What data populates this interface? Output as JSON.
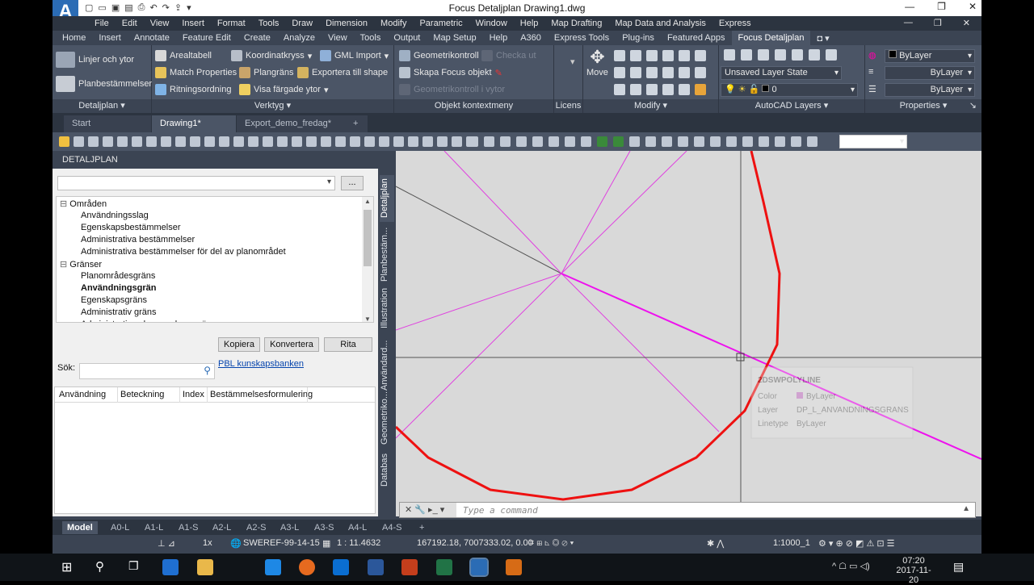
{
  "app": {
    "title": "Focus Detaljplan    Drawing1.dwg",
    "logo_text": "A",
    "logo_sub": "M3D"
  },
  "menubar": [
    "File",
    "Edit",
    "View",
    "Insert",
    "Format",
    "Tools",
    "Draw",
    "Dimension",
    "Modify",
    "Parametric",
    "Window",
    "Help",
    "Map Drafting",
    "Map Data and Analysis",
    "Express"
  ],
  "ribbon_tabs": [
    "Home",
    "Insert",
    "Annotate",
    "Feature Edit",
    "Create",
    "Analyze",
    "View",
    "Tools",
    "Output",
    "Map Setup",
    "Help",
    "A360",
    "Express Tools",
    "Plug-ins",
    "Featured Apps",
    "Focus Detaljplan"
  ],
  "ribbon_active_tab": "Focus Detaljplan",
  "ribbon": {
    "detaljplan": {
      "title": "Detaljplan",
      "btn1": "Linjer och ytor",
      "btn2": "Planbestämmelser"
    },
    "verktyg": {
      "title": "Verktyg",
      "areal": "Arealtabell",
      "koord": "Koordinatkryss",
      "gml": "GML Import",
      "match": "Match Properties",
      "plangrans": "Plangräns",
      "exportera": "Exportera till shape",
      "ritning": "Ritningsordning",
      "visa": "Visa färgade ytor"
    },
    "objekt": {
      "title": "Objekt kontextmeny",
      "geom": "Geometrikontroll",
      "checka": "Checka ut",
      "skapa": "Skapa Focus objekt",
      "geomkontroll": "Geometrikontroll i vytor"
    },
    "licens": {
      "title": "Licens"
    },
    "modify": {
      "title": "Modify",
      "move": "Move"
    },
    "layers": {
      "title": "AutoCAD Layers",
      "state": "Unsaved Layer State",
      "layer0": "0"
    },
    "properties": {
      "title": "Properties",
      "color": "ByLayer",
      "lt1": "ByLayer",
      "lt2": "ByLayer"
    }
  },
  "doc_tabs": [
    "Start",
    "Drawing1*",
    "Export_demo_fredag*"
  ],
  "palette": {
    "header": "DETALJPLAN",
    "dots": "...",
    "tree": [
      {
        "label": "Områden",
        "level": 0,
        "bold": false
      },
      {
        "label": "Användningsslag",
        "level": 1,
        "bold": false
      },
      {
        "label": "Egenskapsbestämmelser",
        "level": 1,
        "bold": false
      },
      {
        "label": "Administrativa bestämmelser",
        "level": 1,
        "bold": false
      },
      {
        "label": "Administrativa bestämmelser för del av planområdet",
        "level": 1,
        "bold": false
      },
      {
        "label": "Gränser",
        "level": 0,
        "bold": false
      },
      {
        "label": "Planområdesgräns",
        "level": 1,
        "bold": false
      },
      {
        "label": "Användningsgrän",
        "level": 1,
        "bold": true
      },
      {
        "label": "Egenskapsgräns",
        "level": 1,
        "bold": false
      },
      {
        "label": "Administrativ gräns",
        "level": 1,
        "bold": false
      },
      {
        "label": "Administrativ och egenskapsgräns",
        "level": 1,
        "bold": false
      }
    ],
    "btn_kopiera": "Kopiera",
    "btn_konvertera": "Konvertera",
    "btn_rita": "Rita",
    "search_label": "Sök:",
    "search_value": "",
    "link": "PBL kunskapsbanken",
    "columns": [
      "Användning",
      "Beteckning",
      "Index",
      "Bestämmelsesformulering"
    ]
  },
  "side_tabs": [
    "Detaljplan",
    "Planbestäm...",
    "Illustration",
    "Användard...",
    "Geometriko...",
    "Databas"
  ],
  "tooltip": {
    "name": "2DSWPOLYLINE",
    "color_label": "Color",
    "color_val": "ByLayer",
    "layer_label": "Layer",
    "layer_val": "DP_L_ANVANDNINGSGRANS",
    "lt_label": "Linetype",
    "lt_val": "ByLayer"
  },
  "command": {
    "placeholder": "Type a command"
  },
  "layout_tabs": [
    "Model",
    "A0-L",
    "A1-L",
    "A1-S",
    "A2-L",
    "A2-S",
    "A3-L",
    "A3-S",
    "A4-L",
    "A4-S"
  ],
  "status": {
    "zoom": "1x",
    "crs": "SWEREF-99-14-15",
    "scale": "1 : 11.4632",
    "coords": "167192.18, 7007333.02, 0.00",
    "anno": "1:1000_1"
  },
  "taskbar": {
    "time": "07:20",
    "date": "2017-11-20"
  },
  "colors": {
    "accent": "#2b6cb5",
    "red_poly": "#ee1111",
    "magenta": "#ee11ee"
  }
}
